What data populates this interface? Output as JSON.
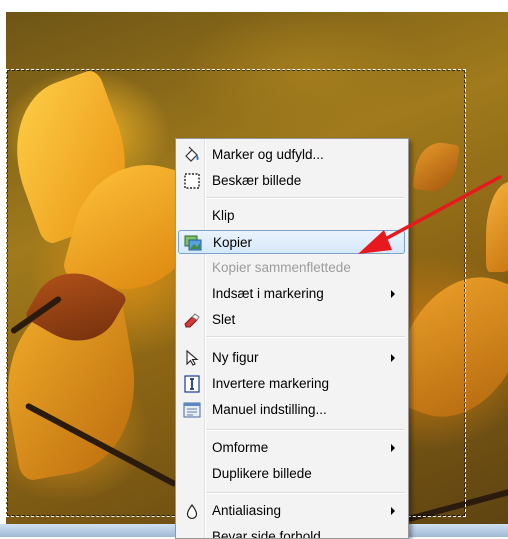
{
  "context_menu": {
    "items": [
      {
        "label": "Marker og udfyld...",
        "icon": "fill-bucket-icon"
      },
      {
        "label": "Beskær billede",
        "icon": "crop-icon"
      },
      {
        "label": "Klip",
        "icon": ""
      },
      {
        "label": "Kopier",
        "icon": "copy-image-icon",
        "state": "highlighted"
      },
      {
        "label": "Kopier sammenflettede",
        "icon": "",
        "state": "disabled"
      },
      {
        "label": "Indsæt i markering",
        "icon": "",
        "submenu": true
      },
      {
        "label": "Slet",
        "icon": "eraser-icon"
      },
      {
        "label": "Ny figur",
        "icon": "pointer-arrow-icon",
        "submenu": true
      },
      {
        "label": "Invertere markering",
        "icon": "invert-selection-icon"
      },
      {
        "label": "Manuel indstilling...",
        "icon": "manual-settings-icon"
      },
      {
        "label": "Omforme",
        "icon": "",
        "submenu": true
      },
      {
        "label": "Duplikere billede",
        "icon": ""
      },
      {
        "label": "Antialiasing",
        "icon": "drop-icon",
        "submenu": true
      },
      {
        "label": "Bevar side forhold",
        "icon": ""
      }
    ]
  },
  "colors": {
    "menu_bg": "#f3f3f3",
    "highlight_border": "#7da2ce",
    "disabled_text": "#9c9c9c",
    "annotation_arrow": "#e8191e"
  }
}
